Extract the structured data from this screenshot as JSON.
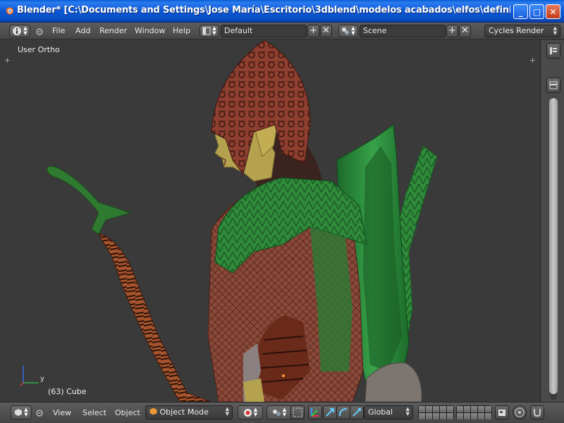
{
  "window": {
    "title": "Blender* [C:\\Documents and Settings\\Jose María\\Escritorio\\3dblend\\modelos acabados\\elfos\\definitivos\\boske...",
    "buttons": [
      "_",
      "□",
      "✕"
    ]
  },
  "header": {
    "menus": [
      "File",
      "Add",
      "Render",
      "Window",
      "Help"
    ],
    "layout_field": "Default",
    "scene_field": "Scene",
    "render_engine": "Cycles Render"
  },
  "viewport": {
    "view_label": "User Ortho",
    "object_label": "(63) Cube",
    "axis_y": "y"
  },
  "footer": {
    "menus": [
      "View",
      "Select",
      "Object"
    ],
    "mode": "Object Mode",
    "orientation": "Global"
  },
  "colors": {
    "accent": "#1b5fe0",
    "ui_dark": "#3a3a3a",
    "outfit_green": "#2e8a3a",
    "leather_brown": "#8a3d2a"
  }
}
